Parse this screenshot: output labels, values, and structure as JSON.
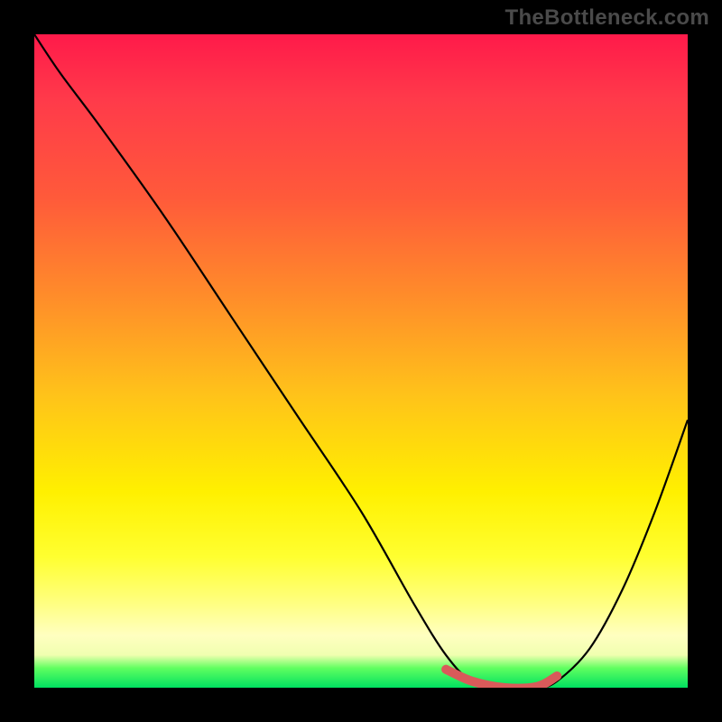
{
  "watermark": "TheBottleneck.com",
  "chart_data": {
    "type": "line",
    "title": "",
    "xlabel": "",
    "ylabel": "",
    "xlim": [
      0,
      1
    ],
    "ylim": [
      0,
      1
    ],
    "series": [
      {
        "name": "curve",
        "x": [
          0.0,
          0.04,
          0.1,
          0.2,
          0.3,
          0.4,
          0.5,
          0.58,
          0.63,
          0.67,
          0.72,
          0.77,
          0.8,
          0.85,
          0.9,
          0.95,
          1.0
        ],
        "values": [
          1.0,
          0.94,
          0.86,
          0.72,
          0.57,
          0.42,
          0.27,
          0.13,
          0.05,
          0.01,
          0.0,
          0.0,
          0.01,
          0.06,
          0.15,
          0.27,
          0.41
        ]
      },
      {
        "name": "highlight-band",
        "x": [
          0.63,
          0.67,
          0.72,
          0.77,
          0.8
        ],
        "values": [
          0.028,
          0.01,
          0.0,
          0.002,
          0.018
        ]
      }
    ],
    "colors": {
      "curve": "#000000",
      "highlight": "#d95a5a",
      "gradient_top": "#ff1a4a",
      "gradient_bottom": "#00e060"
    }
  }
}
